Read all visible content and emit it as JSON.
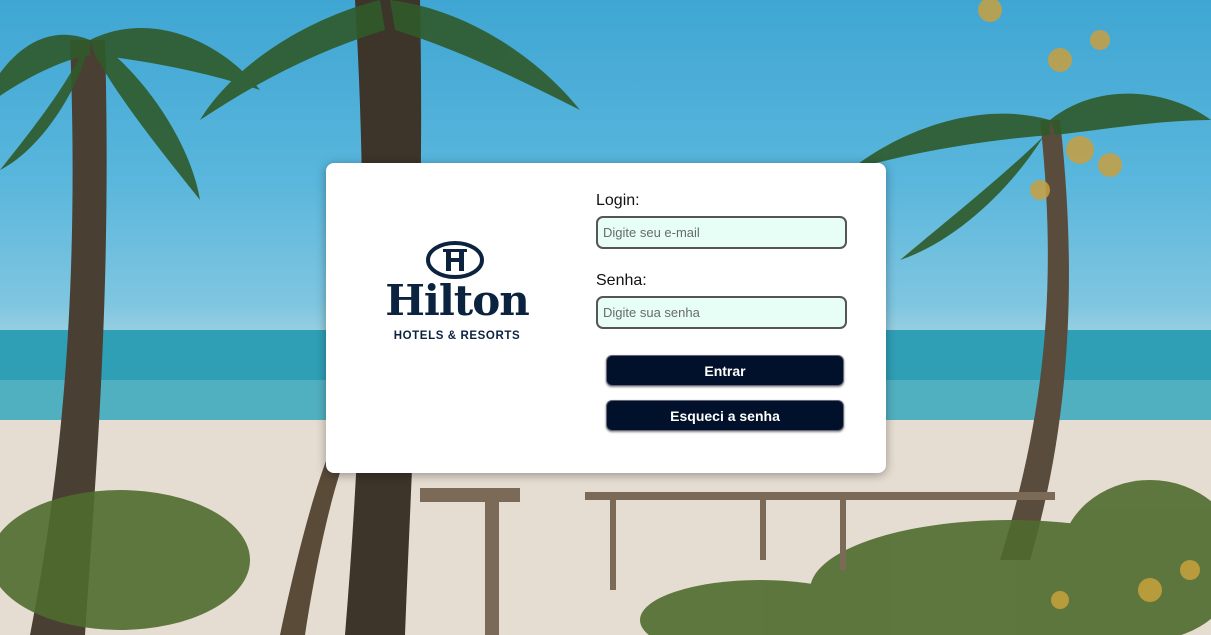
{
  "brand": {
    "name": "Hilton",
    "tagline": "HOTELS & RESORTS",
    "color": "#0c2340"
  },
  "login_form": {
    "login_label": "Login:",
    "login_placeholder": "Digite seu e-mail",
    "password_label": "Senha:",
    "password_placeholder": "Digite sua senha",
    "submit_label": "Entrar",
    "forgot_label": "Esqueci a senha",
    "input_bg": "#e6fef6",
    "button_bg": "#02112b"
  },
  "background": {
    "description_icon": "beach-palm-background"
  }
}
